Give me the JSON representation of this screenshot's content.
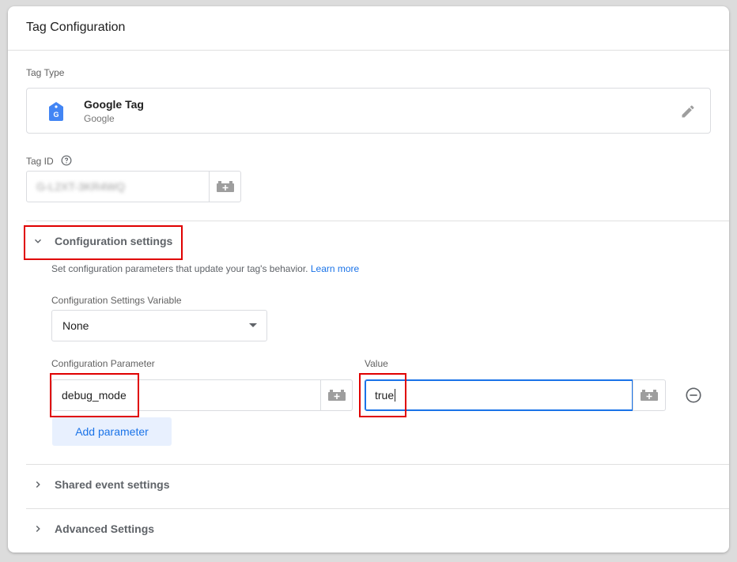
{
  "header": {
    "title": "Tag Configuration"
  },
  "tag_type": {
    "label": "Tag Type",
    "name": "Google Tag",
    "vendor": "Google",
    "icon": "google-tag-icon",
    "icon_color": "#4285f4"
  },
  "tag_id": {
    "label": "Tag ID",
    "value": "G-L2XT-3KR4WQ"
  },
  "config_section": {
    "label": "Configuration settings",
    "expanded": true,
    "description": "Set configuration parameters that update your tag's behavior.",
    "learn_more": "Learn more",
    "variable_label": "Configuration Settings Variable",
    "variable_value": "None",
    "param_label": "Configuration Parameter",
    "value_label": "Value",
    "param_value": "debug_mode",
    "value_value": "true",
    "add_button": "Add parameter"
  },
  "shared_section": {
    "label": "Shared event settings",
    "expanded": false
  },
  "advanced_section": {
    "label": "Advanced Settings",
    "expanded": false
  },
  "colors": {
    "accent": "#1a73e8",
    "highlight": "#e00000",
    "add_button_bg": "#e8f0fe"
  }
}
